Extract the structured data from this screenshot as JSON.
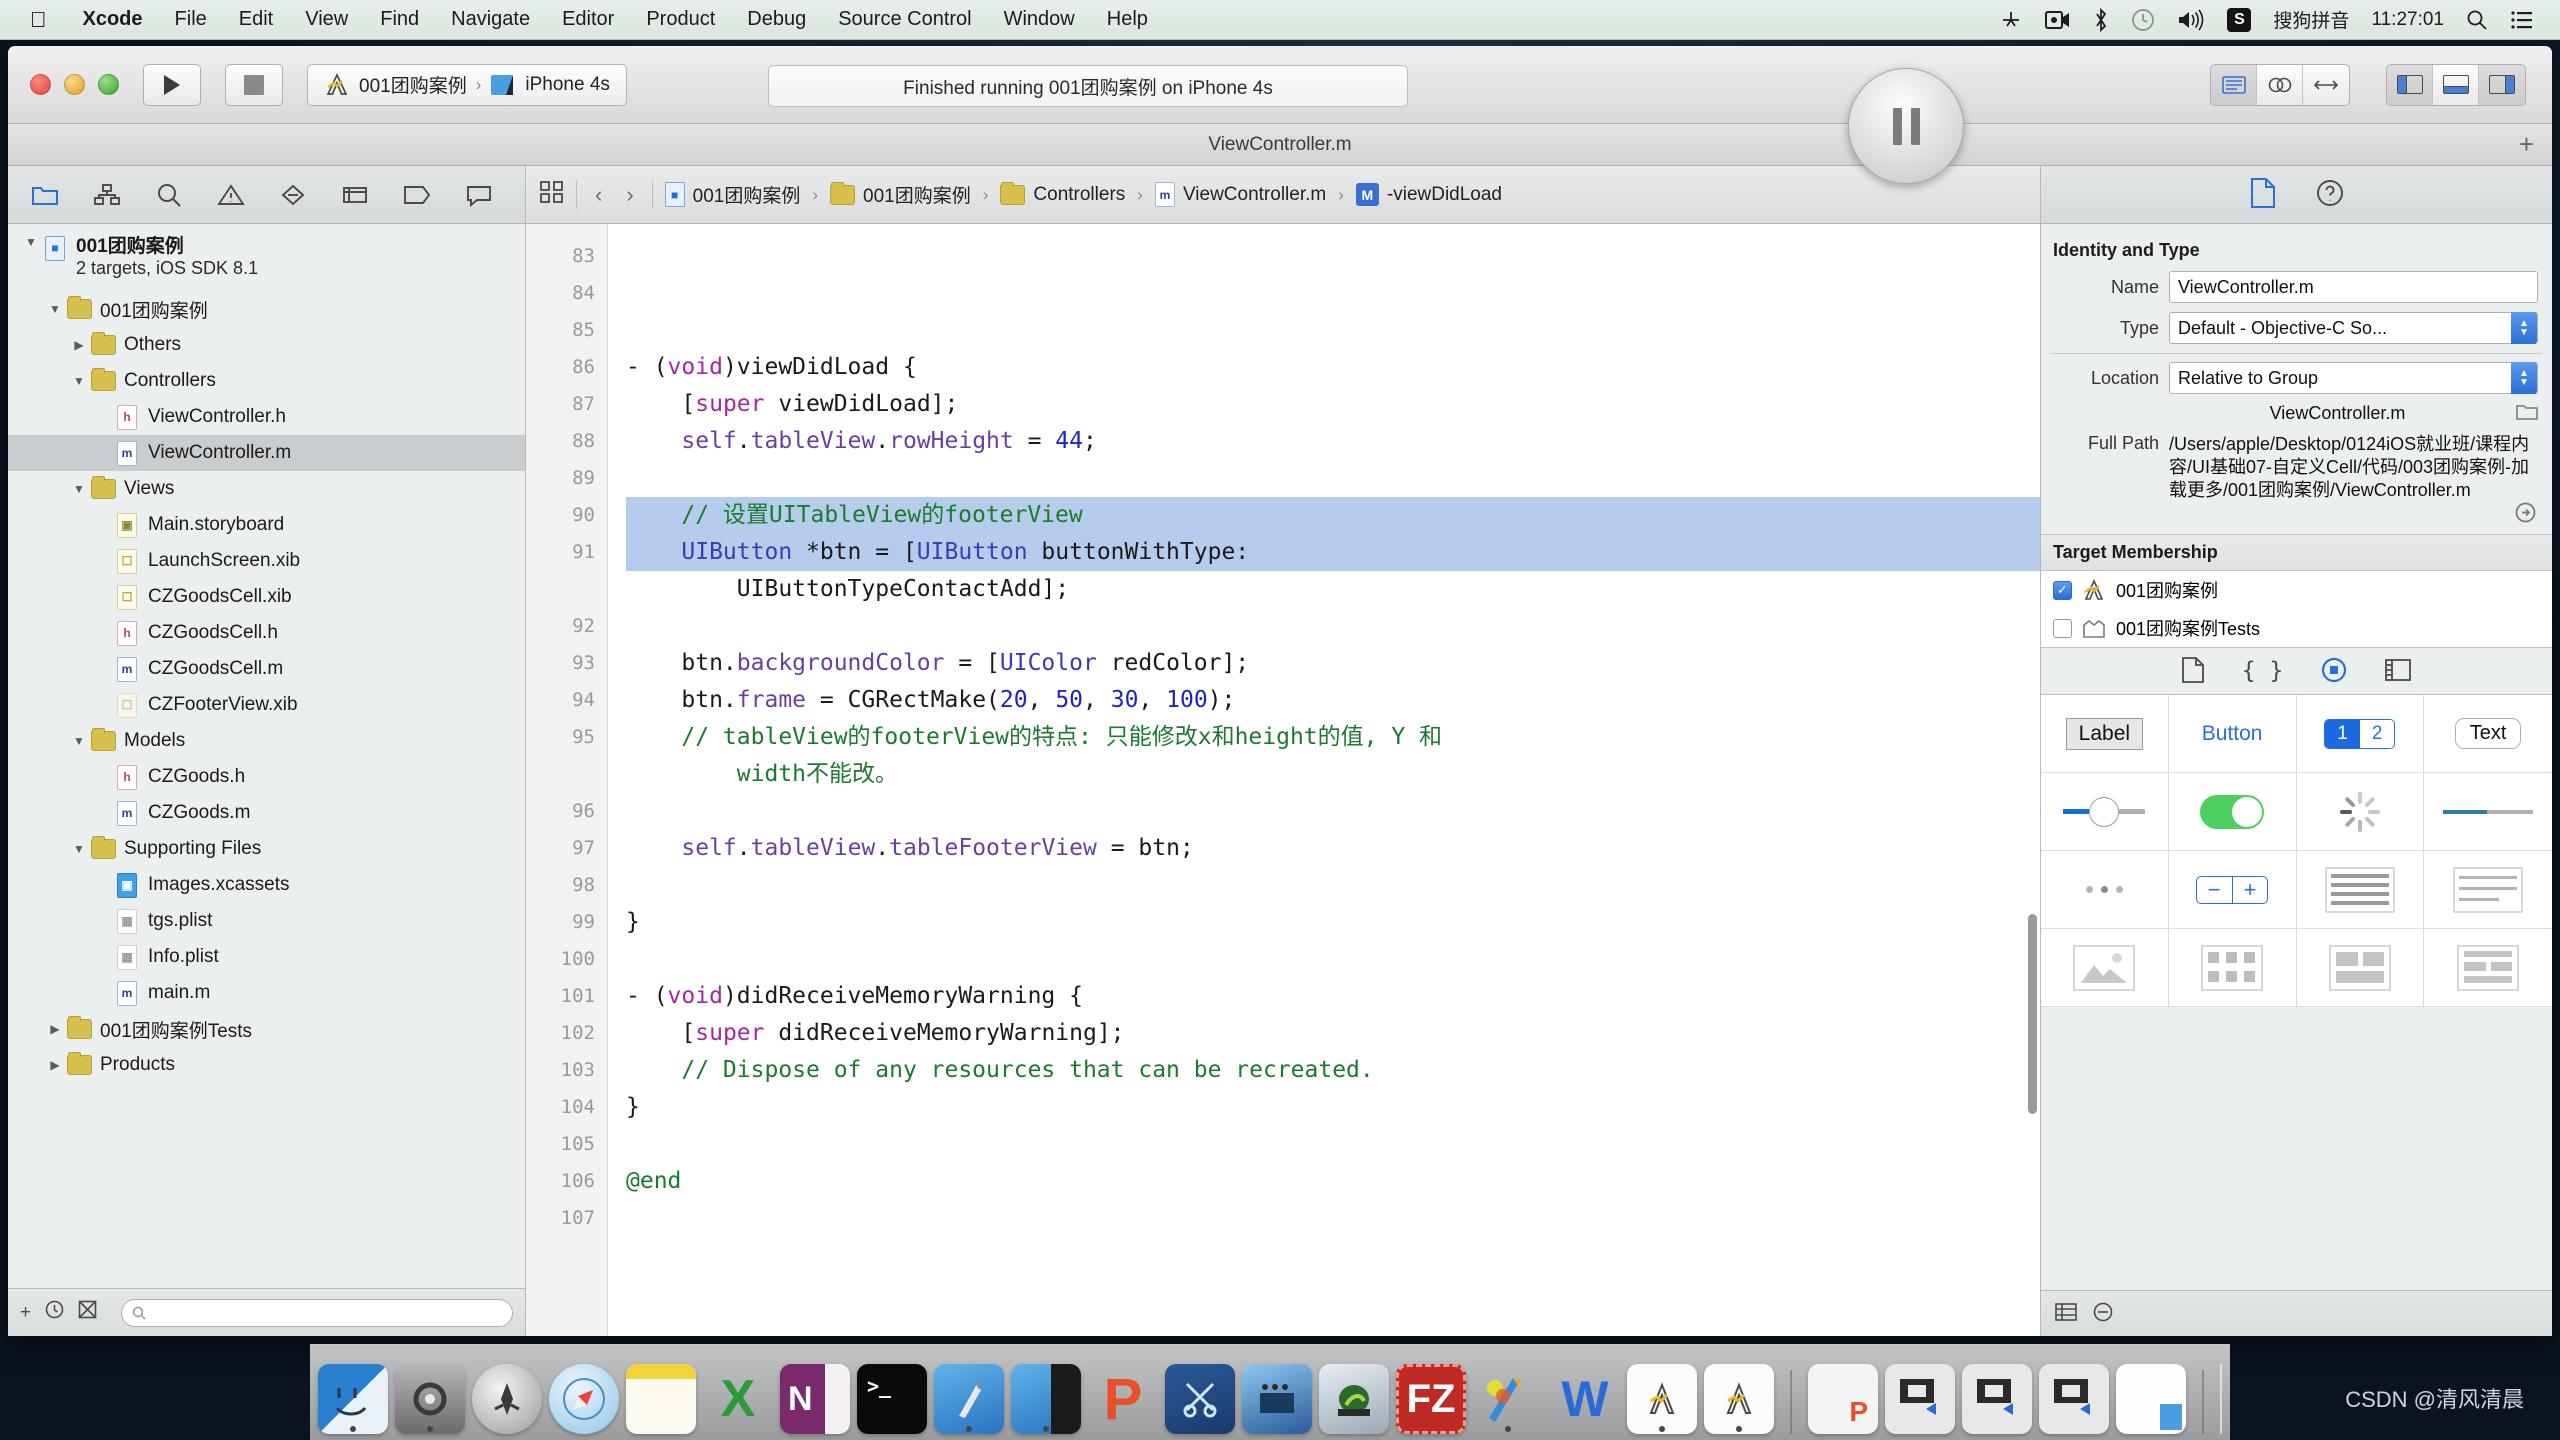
{
  "menubar": {
    "apple_icon": "apple-icon",
    "items": [
      "Xcode",
      "File",
      "Edit",
      "View",
      "Find",
      "Navigate",
      "Editor",
      "Product",
      "Debug",
      "Source Control",
      "Window",
      "Help"
    ],
    "status": {
      "icons": [
        "airplay-icon",
        "screen-record-icon",
        "bluetooth-icon",
        "time-machine-icon",
        "volume-icon"
      ],
      "input_method_badge": "S",
      "input_method": "搜狗拼音",
      "clock": "11:27:01",
      "search_icon": "search-icon",
      "notification_icon": "notification-center-icon"
    }
  },
  "toolbar": {
    "run_icon": "play-icon",
    "stop_icon": "stop-icon",
    "scheme_project": "001团购案例",
    "scheme_sep": "›",
    "scheme_device": "iPhone 4s",
    "status_text": "Finished running 001团购案例 on iPhone 4s",
    "pause_icon": "pause-icon",
    "editor_modes": [
      "standard-editor-icon",
      "assistant-editor-icon",
      "version-editor-icon"
    ],
    "view_toggles": [
      "navigator-toggle-icon",
      "debug-area-toggle-icon",
      "utilities-toggle-icon"
    ]
  },
  "window": {
    "title": "ViewController.m",
    "add_tab_icon": "plus-icon"
  },
  "navigator": {
    "tabs": [
      "project-navigator-icon",
      "symbol-navigator-icon",
      "find-navigator-icon",
      "issue-navigator-icon",
      "test-navigator-icon",
      "debug-navigator-icon",
      "breakpoint-navigator-icon",
      "report-navigator-icon"
    ],
    "tree": [
      {
        "label": "001团购案例",
        "sub": "2 targets, iOS SDK 8.1",
        "kind": "project",
        "indent": 0,
        "twisty": "down",
        "selected": false
      },
      {
        "label": "001团购案例",
        "kind": "folder",
        "indent": 1,
        "twisty": "down",
        "selected": false
      },
      {
        "label": "Others",
        "kind": "folder",
        "indent": 2,
        "twisty": "right",
        "selected": false
      },
      {
        "label": "Controllers",
        "kind": "folder",
        "indent": 2,
        "twisty": "down",
        "selected": false
      },
      {
        "label": "ViewController.h",
        "kind": "h",
        "indent": 3,
        "twisty": "",
        "selected": false
      },
      {
        "label": "ViewController.m",
        "kind": "m",
        "indent": 3,
        "twisty": "",
        "selected": true
      },
      {
        "label": "Views",
        "kind": "folder",
        "indent": 2,
        "twisty": "down",
        "selected": false
      },
      {
        "label": "Main.storyboard",
        "kind": "sb",
        "indent": 3,
        "twisty": "",
        "selected": false
      },
      {
        "label": "LaunchScreen.xib",
        "kind": "xib",
        "indent": 3,
        "twisty": "",
        "selected": false
      },
      {
        "label": "CZGoodsCell.xib",
        "kind": "xib",
        "indent": 3,
        "twisty": "",
        "selected": false
      },
      {
        "label": "CZGoodsCell.h",
        "kind": "h",
        "indent": 3,
        "twisty": "",
        "selected": false
      },
      {
        "label": "CZGoodsCell.m",
        "kind": "m",
        "indent": 3,
        "twisty": "",
        "selected": false
      },
      {
        "label": "CZFooterView.xib",
        "kind": "xibdim",
        "indent": 3,
        "twisty": "",
        "selected": false
      },
      {
        "label": "Models",
        "kind": "folder",
        "indent": 2,
        "twisty": "down",
        "selected": false
      },
      {
        "label": "CZGoods.h",
        "kind": "h",
        "indent": 3,
        "twisty": "",
        "selected": false
      },
      {
        "label": "CZGoods.m",
        "kind": "m",
        "indent": 3,
        "twisty": "",
        "selected": false
      },
      {
        "label": "Supporting Files",
        "kind": "folder",
        "indent": 2,
        "twisty": "down",
        "selected": false
      },
      {
        "label": "Images.xcassets",
        "kind": "xcassets",
        "indent": 3,
        "twisty": "",
        "selected": false
      },
      {
        "label": "tgs.plist",
        "kind": "plist",
        "indent": 3,
        "twisty": "",
        "selected": false
      },
      {
        "label": "Info.plist",
        "kind": "plist",
        "indent": 3,
        "twisty": "",
        "selected": false
      },
      {
        "label": "main.m",
        "kind": "m",
        "indent": 3,
        "twisty": "",
        "selected": false
      },
      {
        "label": "001团购案例Tests",
        "kind": "folder",
        "indent": 1,
        "twisty": "right",
        "selected": false
      },
      {
        "label": "Products",
        "kind": "folder",
        "indent": 1,
        "twisty": "right",
        "selected": false
      }
    ],
    "footer": {
      "add_icon": "plus-icon",
      "recent_icon": "clock-icon",
      "sourcecontrol_icon": "source-control-filter-icon",
      "filter_placeholder": "",
      "filter_icon": "filter-icon"
    }
  },
  "jumpbar": {
    "related_icon": "related-items-icon",
    "back_icon": "chevron-left-icon",
    "forward_icon": "chevron-right-icon",
    "crumbs": [
      {
        "label": "001团购案例",
        "kind": "project"
      },
      {
        "label": "001团购案例",
        "kind": "folder"
      },
      {
        "label": "Controllers",
        "kind": "folder"
      },
      {
        "label": "ViewController.m",
        "kind": "m"
      },
      {
        "label": "-viewDidLoad",
        "kind": "method"
      }
    ],
    "sep": "›"
  },
  "code": {
    "first_line": 83,
    "lines": [
      {
        "n": 83,
        "tokens": [],
        "highlight": false
      },
      {
        "n": 84,
        "tokens": [],
        "highlight": false
      },
      {
        "n": 85,
        "tokens": [],
        "highlight": false
      },
      {
        "n": 86,
        "tokens": [
          [
            "pl",
            "- ("
          ],
          [
            "kw",
            "void"
          ],
          [
            "pl",
            ")viewDidLoad {"
          ]
        ],
        "highlight": false
      },
      {
        "n": 87,
        "tokens": [
          [
            "pl",
            "    ["
          ],
          [
            "kw",
            "super"
          ],
          [
            "pl",
            " viewDidLoad];"
          ]
        ],
        "highlight": false
      },
      {
        "n": 88,
        "tokens": [
          [
            "pl",
            "    "
          ],
          [
            "prop",
            "self"
          ],
          [
            "pl",
            "."
          ],
          [
            "prop",
            "tableView"
          ],
          [
            "pl",
            "."
          ],
          [
            "prop",
            "rowHeight"
          ],
          [
            "pl",
            " = "
          ],
          [
            "num",
            "44"
          ],
          [
            "pl",
            ";"
          ]
        ],
        "highlight": false
      },
      {
        "n": 89,
        "tokens": [],
        "highlight": false
      },
      {
        "n": 90,
        "tokens": [
          [
            "pl",
            "    "
          ],
          [
            "cm",
            "// 设置UITableView的footerView"
          ]
        ],
        "highlight": true
      },
      {
        "n": 91,
        "tokens": [
          [
            "pl",
            "    "
          ],
          [
            "cls",
            "UIButton"
          ],
          [
            "pl",
            " *btn = ["
          ],
          [
            "cls",
            "UIButton"
          ],
          [
            "pl",
            " buttonWithType:"
          ]
        ],
        "highlight": true
      },
      {
        "n": "",
        "tokens": [
          [
            "pl",
            "        UIButtonTypeContactAdd];"
          ]
        ],
        "highlight": false
      },
      {
        "n": 92,
        "tokens": [],
        "highlight": false
      },
      {
        "n": 93,
        "tokens": [
          [
            "pl",
            "    btn."
          ],
          [
            "prop",
            "backgroundColor"
          ],
          [
            "pl",
            " = ["
          ],
          [
            "cls",
            "UIColor"
          ],
          [
            "pl",
            " redColor];"
          ]
        ],
        "highlight": false
      },
      {
        "n": 94,
        "tokens": [
          [
            "pl",
            "    btn."
          ],
          [
            "prop",
            "frame"
          ],
          [
            "pl",
            " = CGRectMake("
          ],
          [
            "num",
            "20"
          ],
          [
            "pl",
            ", "
          ],
          [
            "num",
            "50"
          ],
          [
            "pl",
            ", "
          ],
          [
            "num",
            "30"
          ],
          [
            "pl",
            ", "
          ],
          [
            "num",
            "100"
          ],
          [
            "pl",
            ");"
          ]
        ],
        "highlight": false
      },
      {
        "n": 95,
        "tokens": [
          [
            "pl",
            "    "
          ],
          [
            "cm",
            "// tableView的footerView的特点: 只能修改x和height的值, Y 和"
          ]
        ],
        "highlight": false
      },
      {
        "n": "",
        "tokens": [
          [
            "pl",
            "        "
          ],
          [
            "cm",
            "width不能改。"
          ]
        ],
        "highlight": false
      },
      {
        "n": 96,
        "tokens": [],
        "highlight": false
      },
      {
        "n": 97,
        "tokens": [
          [
            "pl",
            "    "
          ],
          [
            "prop",
            "self"
          ],
          [
            "pl",
            "."
          ],
          [
            "prop",
            "tableView"
          ],
          [
            "pl",
            "."
          ],
          [
            "prop",
            "tableFooterView"
          ],
          [
            "pl",
            " = btn;"
          ]
        ],
        "highlight": false
      },
      {
        "n": 98,
        "tokens": [],
        "highlight": false
      },
      {
        "n": 99,
        "tokens": [
          [
            "pl",
            "}"
          ]
        ],
        "highlight": false
      },
      {
        "n": 100,
        "tokens": [],
        "highlight": false
      },
      {
        "n": 101,
        "tokens": [
          [
            "pl",
            "- ("
          ],
          [
            "kw",
            "void"
          ],
          [
            "pl",
            ")didReceiveMemoryWarning {"
          ]
        ],
        "highlight": false
      },
      {
        "n": 102,
        "tokens": [
          [
            "pl",
            "    ["
          ],
          [
            "kw",
            "super"
          ],
          [
            "pl",
            " didReceiveMemoryWarning];"
          ]
        ],
        "highlight": false
      },
      {
        "n": 103,
        "tokens": [
          [
            "pl",
            "    "
          ],
          [
            "cm",
            "// Dispose of any resources that can be recreated."
          ]
        ],
        "highlight": false
      },
      {
        "n": 104,
        "tokens": [
          [
            "pl",
            "}"
          ]
        ],
        "highlight": false
      },
      {
        "n": 105,
        "tokens": [],
        "highlight": false
      },
      {
        "n": 106,
        "tokens": [
          [
            "cm",
            "@end"
          ]
        ],
        "highlight": false
      },
      {
        "n": 107,
        "tokens": [],
        "highlight": false
      }
    ]
  },
  "inspector": {
    "tabs": [
      "file-inspector-icon",
      "quick-help-icon"
    ],
    "identity_section": "Identity and Type",
    "name_label": "Name",
    "name_value": "ViewController.m",
    "type_label": "Type",
    "type_value": "Default - Objective-C So...",
    "location_label": "Location",
    "location_value": "Relative to Group",
    "location_filename": "ViewController.m",
    "folder_icon": "folder-choose-icon",
    "fullpath_label": "Full Path",
    "fullpath_value": "/Users/apple/Desktop/0124iOS就业班/课程内容/UI基础07-自定义Cell/代码/003团购案例-加载更多/001团购案例/ViewController.m",
    "reveal_icon": "reveal-in-finder-icon",
    "target_membership": "Target Membership",
    "targets": [
      {
        "label": "001团购案例",
        "checked": true,
        "icon": "app-target-icon"
      },
      {
        "label": "001团购案例Tests",
        "checked": false,
        "icon": "test-target-icon"
      }
    ],
    "library_tabs": [
      "file-template-library-icon",
      "code-snippet-library-icon",
      "object-library-icon",
      "media-library-icon"
    ],
    "library_items": [
      {
        "name": "Label",
        "kind": "label"
      },
      {
        "name": "Button",
        "kind": "button"
      },
      {
        "name": "1",
        "name2": "2",
        "kind": "segmented"
      },
      {
        "name": "Text",
        "kind": "textfield"
      },
      {
        "name": "Slider",
        "kind": "slider"
      },
      {
        "name": "Switch",
        "kind": "switch"
      },
      {
        "name": "Activity Indicator",
        "kind": "activity"
      },
      {
        "name": "Progress View",
        "kind": "progress"
      },
      {
        "name": "Page Control",
        "kind": "pagecontrol"
      },
      {
        "name": "Stepper",
        "kind": "stepper"
      },
      {
        "name": "Table View",
        "kind": "tableview"
      },
      {
        "name": "Table View Cell",
        "kind": "tablecell"
      },
      {
        "name": "Image View",
        "kind": "imageview"
      },
      {
        "name": "Collection View",
        "kind": "collectionview"
      },
      {
        "name": "Collection View Cell",
        "kind": "collectioncell"
      },
      {
        "name": "Collection Reusable View",
        "kind": "collectionreusable"
      }
    ],
    "footer_icons": [
      "list-view-icon",
      "filter-icon"
    ]
  },
  "dock": {
    "items": [
      {
        "name": "finder",
        "running": true
      },
      {
        "name": "system-preferences",
        "running": true
      },
      {
        "name": "launchpad",
        "running": false
      },
      {
        "name": "safari",
        "running": false
      },
      {
        "name": "stickies",
        "running": false
      },
      {
        "name": "excel",
        "running": false
      },
      {
        "name": "onenote",
        "running": false
      },
      {
        "name": "terminal",
        "running": false
      },
      {
        "name": "xcode",
        "running": true
      },
      {
        "name": "xcode-beta",
        "running": true
      },
      {
        "name": "pycharm",
        "running": true
      },
      {
        "name": "snipaste",
        "running": false
      },
      {
        "name": "quicktime",
        "running": false
      },
      {
        "name": "thunder",
        "running": false
      },
      {
        "name": "filezilla",
        "running": false
      },
      {
        "name": "sketch",
        "running": true
      },
      {
        "name": "word",
        "running": false
      },
      {
        "name": "preview-a",
        "running": true
      },
      {
        "name": "preview-b",
        "running": true
      }
    ],
    "recent": [
      {
        "name": "recent-pdf"
      },
      {
        "name": "recent-screen-1"
      },
      {
        "name": "recent-screen-2"
      },
      {
        "name": "recent-screen-3"
      },
      {
        "name": "recent-doc"
      }
    ],
    "trash": "trash-icon"
  },
  "watermark": "CSDN @清风清晨"
}
